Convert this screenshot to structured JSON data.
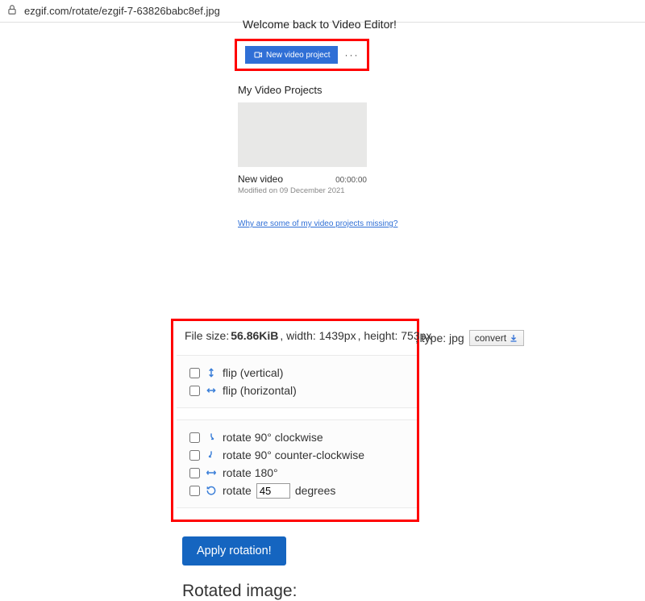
{
  "address_bar": {
    "url": "ezgif.com/rotate/ezgif-7-63826babc8ef.jpg"
  },
  "video_editor": {
    "heading": "Welcome back to Video Editor!",
    "new_button": "New video project",
    "more": "···",
    "subtitle": "My Video Projects",
    "card": {
      "title": "New video",
      "duration": "00:00:00",
      "modified": "Modified on 09 December 2021"
    },
    "missing_link": "Why are some of my video projects missing?"
  },
  "file_info": {
    "size_label": "File size: ",
    "size_value": "56.86KiB",
    "width_label": ", width: 1439px",
    "height_label": ", height: 753px",
    "type_label": ", type: jpg",
    "convert_label": "convert"
  },
  "options": {
    "flip_v": "flip (vertical)",
    "flip_h": "flip (horizontal)",
    "rot_cw": "rotate 90° clockwise",
    "rot_ccw": "rotate 90° counter-clockwise",
    "rot_180": "rotate 180°",
    "rot_custom_prefix": "rotate",
    "rot_custom_value": "45",
    "rot_custom_suffix": "degrees"
  },
  "apply_label": "Apply rotation!",
  "rotated_heading": "Rotated image:"
}
